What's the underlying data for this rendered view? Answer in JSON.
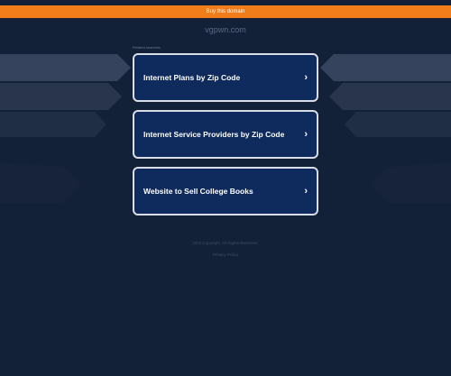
{
  "banner": {
    "label": "Buy this domain",
    "color": "#f07c1a"
  },
  "header": {
    "domain": "vgpwn.com",
    "related_label": "Related searches"
  },
  "results": [
    {
      "label": "Internet Plans by Zip Code",
      "icon": "chevron-right-icon",
      "chevron": "›"
    },
    {
      "label": "Internet Service Providers by Zip Code",
      "icon": "chevron-right-icon",
      "chevron": "›"
    },
    {
      "label": "Website to Sell College Books",
      "icon": "chevron-right-icon",
      "chevron": "›"
    }
  ],
  "footer": {
    "copyright": "2022 Copyright. All Rights Reserved.",
    "privacy": "Privacy Policy"
  },
  "colors": {
    "background": "#122038",
    "result_box": "#0f2a5c",
    "result_border": "#d9dde5"
  }
}
